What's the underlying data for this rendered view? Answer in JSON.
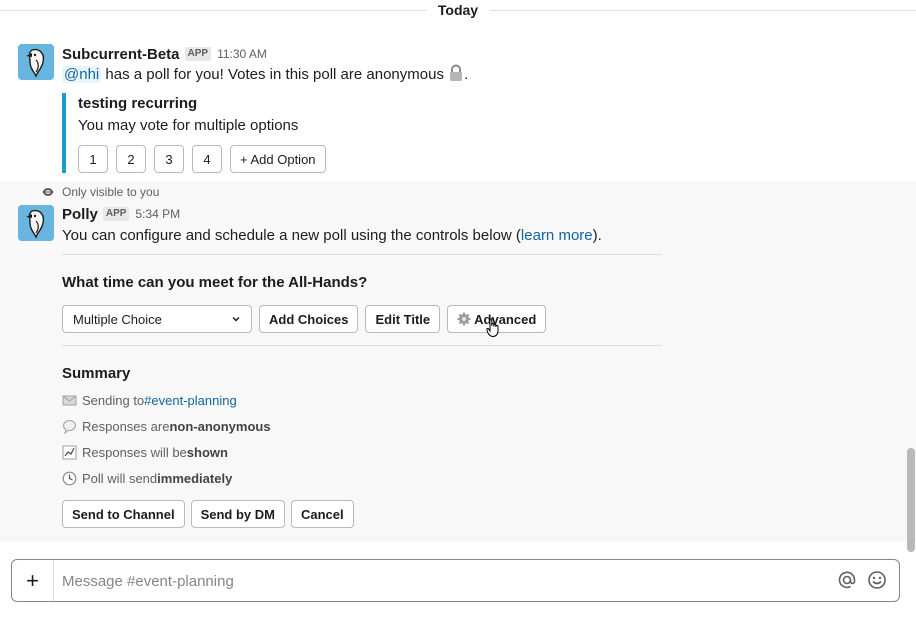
{
  "day_divider": "Today",
  "message1": {
    "sender": "Subcurrent-Beta",
    "badge": "APP",
    "time": "11:30 AM",
    "mention": "@nhi",
    "text": " has a poll for you! Votes in this poll are anonymous ",
    "text_end": ".",
    "lock_icon": "lock-icon",
    "attachment": {
      "title": "testing recurring",
      "subtitle": "You may vote for multiple options",
      "options": [
        "1",
        "2",
        "3",
        "4"
      ],
      "add_option_label": "+ Add Option"
    }
  },
  "ephemeral": {
    "visibility_note": "Only visible to you",
    "sender": "Polly",
    "badge": "APP",
    "time": "5:34 PM",
    "text_before": "You can configure and schedule a new poll using the controls below (",
    "link_text": "learn more",
    "text_after": ").",
    "question": "What time can you meet for the All-Hands?",
    "poll_type": "Multiple Choice",
    "add_choices_label": "Add Choices",
    "edit_title_label": "Edit Title",
    "advanced_label": "Advanced",
    "summary": {
      "title": "Summary",
      "sending_prefix": "Sending to ",
      "channel": "#event-planning",
      "responses_prefix": "Responses are ",
      "responses_value": "non-anonymous",
      "shown_prefix": "Responses will be ",
      "shown_value": "shown",
      "send_prefix": "Poll will send ",
      "send_value": "immediately"
    },
    "send_to_channel_label": "Send to Channel",
    "send_by_dm_label": "Send by DM",
    "cancel_label": "Cancel"
  },
  "composer": {
    "plus": "+",
    "placeholder": "Message #event-planning"
  },
  "colors": {
    "accent": "#1d9bd1",
    "link": "#1264a3",
    "avatar": "#68b6df"
  }
}
